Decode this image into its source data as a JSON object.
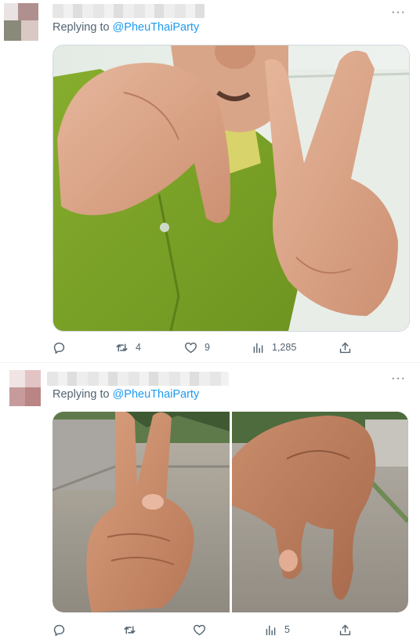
{
  "tweets": [
    {
      "reply_prefix": "Replying to ",
      "reply_handle": "@PheuThaiParty",
      "more_label": "···",
      "media": [
        {
          "alt": "man in green polo shirt making a hand sign"
        }
      ],
      "actions": {
        "reply": "",
        "retweet": "4",
        "like": "9",
        "views": "1,285",
        "share": ""
      }
    },
    {
      "reply_prefix": "Replying to ",
      "reply_handle": "@PheuThaiParty",
      "more_label": "···",
      "media": [
        {
          "alt": "hand making V sign"
        },
        {
          "alt": "hand making a curled finger sign"
        }
      ],
      "actions": {
        "reply": "",
        "retweet": "",
        "like": "",
        "views": "5",
        "share": ""
      }
    }
  ],
  "icons": [
    "reply-icon",
    "retweet-icon",
    "like-icon",
    "views-icon",
    "share-icon",
    "more-icon"
  ],
  "colors": {
    "link": "#1d9bf0",
    "muted": "#536471",
    "border": "#cfd9de",
    "shirt": "#7fa62a",
    "skin": "#d9a283"
  }
}
